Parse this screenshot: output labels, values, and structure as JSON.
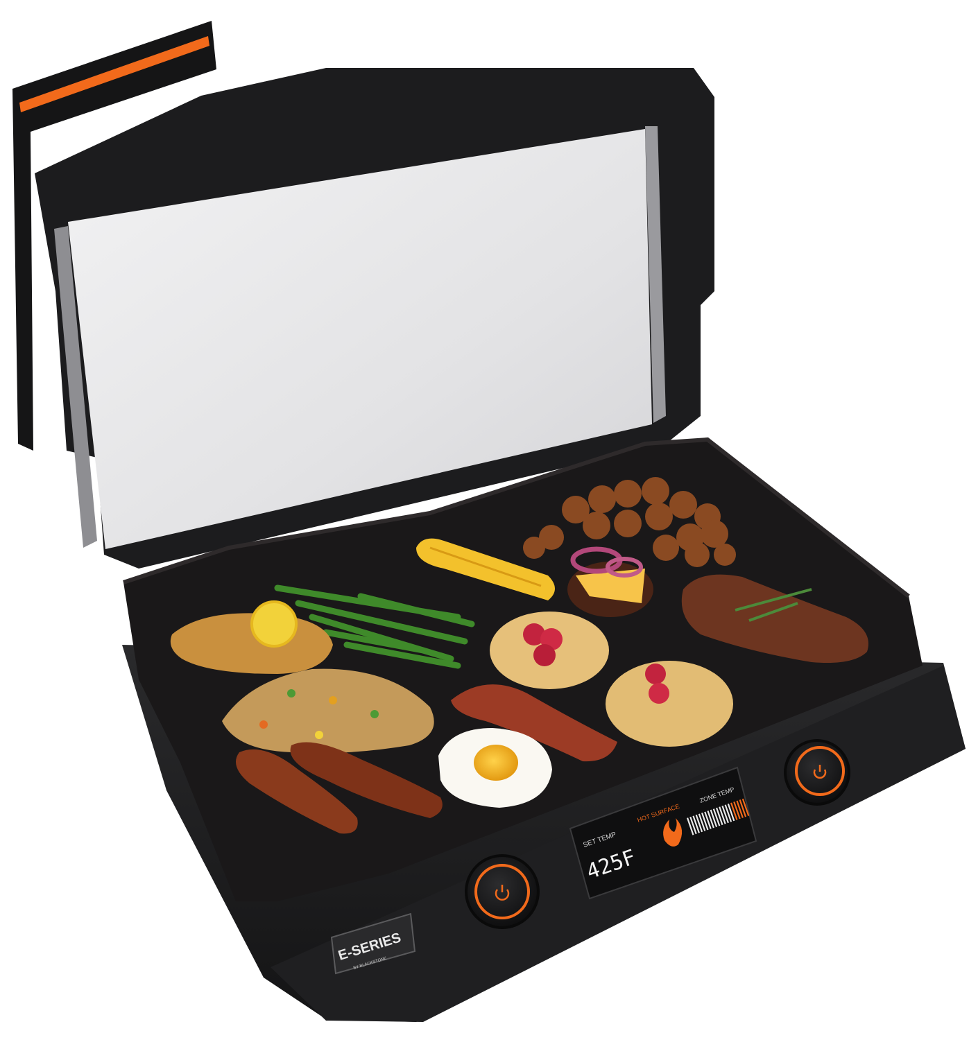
{
  "product": {
    "brand_logo": {
      "mark": "E-SERIES",
      "sub": "BY BLACKSTONE"
    },
    "display": {
      "set_temp_label": "SET TEMP",
      "set_temp_value": "425F",
      "hot_surface_label": "HOT SURFACE",
      "zone_temp_label": "ZONE TEMP",
      "zone_temp_level": 0.75
    },
    "colors": {
      "accent_orange": "#f26a1b",
      "body_black": "#1d1d1f",
      "griddle_black": "#1a1819",
      "glass": "#e4e4e6"
    },
    "knobs": [
      "left-knob",
      "right-knob"
    ],
    "food_items": [
      "chicken-breast",
      "green-beans",
      "corn-cob",
      "potatoes",
      "burger",
      "steak",
      "fried-rice",
      "pancakes",
      "bacon",
      "fried-egg",
      "sausages"
    ]
  }
}
